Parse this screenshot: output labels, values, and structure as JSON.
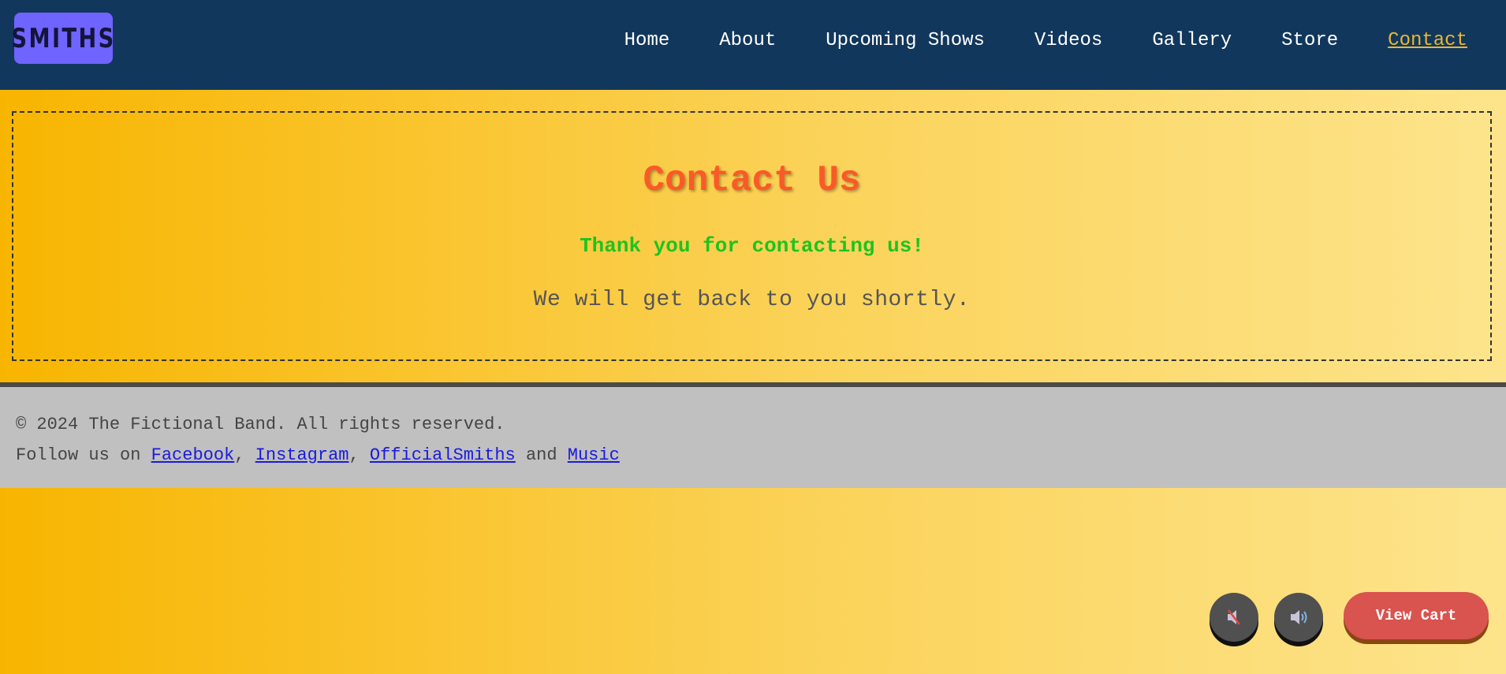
{
  "header": {
    "logo_text": "SMITHS",
    "nav": [
      {
        "label": "Home"
      },
      {
        "label": "About"
      },
      {
        "label": "Upcoming Shows"
      },
      {
        "label": "Videos"
      },
      {
        "label": "Gallery"
      },
      {
        "label": "Store"
      },
      {
        "label": "Contact",
        "active": true
      }
    ]
  },
  "contact": {
    "title": "Contact Us",
    "thanks": "Thank you for contacting us!",
    "message": "We will get back to you shortly."
  },
  "footer": {
    "copyright": "© 2024 The Fictional Band. All rights reserved.",
    "follow_prefix": "Follow us on",
    "links": {
      "facebook": "Facebook",
      "instagram": "Instagram",
      "official": "OfficialSmiths",
      "music": "Music"
    },
    "separator_comma": ",",
    "separator_and": "and"
  },
  "controls": {
    "mute_icon": "mute-icon",
    "sound_icon": "sound-on-icon",
    "cart_label": "View Cart"
  },
  "colors": {
    "header_bg": "#12375c",
    "logo_bg": "#6f64ff",
    "title": "#fa5a28",
    "thanks": "#1ec31e",
    "link": "#1a1adc",
    "active_nav": "#e6b833",
    "cart_bg": "#d9534f"
  }
}
